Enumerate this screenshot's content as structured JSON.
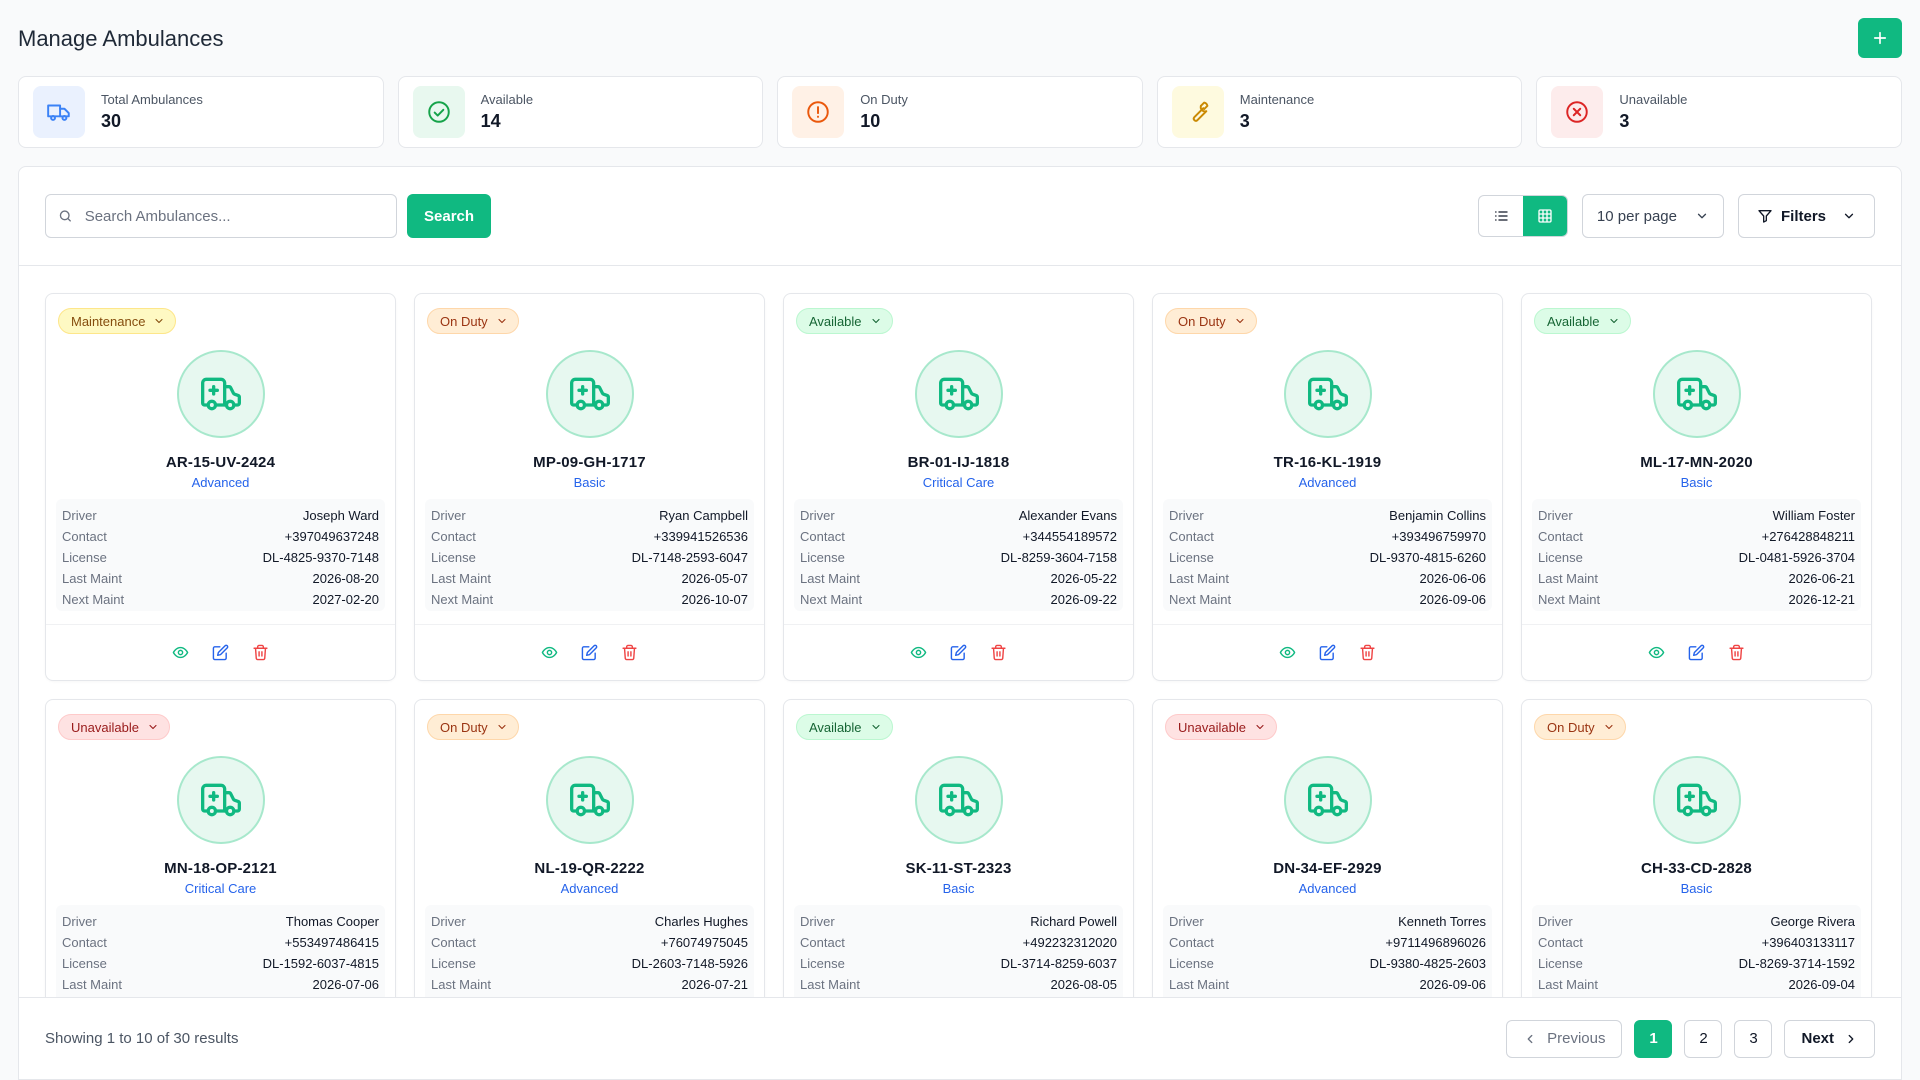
{
  "header": {
    "title": "Manage Ambulances"
  },
  "stats": [
    {
      "label": "Total Ambulances",
      "value": "30",
      "icon": "truck-icon"
    },
    {
      "label": "Available",
      "value": "14",
      "icon": "check-circle-icon"
    },
    {
      "label": "On Duty",
      "value": "10",
      "icon": "alert-circle-icon"
    },
    {
      "label": "Maintenance",
      "value": "3",
      "icon": "wrench-icon"
    },
    {
      "label": "Unavailable",
      "value": "3",
      "icon": "x-circle-icon"
    }
  ],
  "toolbar": {
    "search_placeholder": "Search Ambulances...",
    "search_label": "Search",
    "per_page": "10 per page",
    "filters_label": "Filters"
  },
  "labels": {
    "driver": "Driver",
    "contact": "Contact",
    "license": "License",
    "last_maint": "Last Maint",
    "next_maint": "Next Maint"
  },
  "cards": [
    {
      "status": "Maintenance",
      "plate": "AR-15-UV-2424",
      "type": "Advanced",
      "driver": "Joseph Ward",
      "contact": "+397049637248",
      "license": "DL-4825-9370-7148",
      "last_maint": "2026-08-20",
      "next_maint": "2027-02-20"
    },
    {
      "status": "On Duty",
      "plate": "MP-09-GH-1717",
      "type": "Basic",
      "driver": "Ryan Campbell",
      "contact": "+339941526536",
      "license": "DL-7148-2593-6047",
      "last_maint": "2026-05-07",
      "next_maint": "2026-10-07"
    },
    {
      "status": "Available",
      "plate": "BR-01-IJ-1818",
      "type": "Critical Care",
      "driver": "Alexander Evans",
      "contact": "+344554189572",
      "license": "DL-8259-3604-7158",
      "last_maint": "2026-05-22",
      "next_maint": "2026-09-22"
    },
    {
      "status": "On Duty",
      "plate": "TR-16-KL-1919",
      "type": "Advanced",
      "driver": "Benjamin Collins",
      "contact": "+393496759970",
      "license": "DL-9370-4815-6260",
      "last_maint": "2026-06-06",
      "next_maint": "2026-09-06"
    },
    {
      "status": "Available",
      "plate": "ML-17-MN-2020",
      "type": "Basic",
      "driver": "William Foster",
      "contact": "+276428848211",
      "license": "DL-0481-5926-3704",
      "last_maint": "2026-06-21",
      "next_maint": "2026-12-21"
    },
    {
      "status": "Unavailable",
      "plate": "MN-18-OP-2121",
      "type": "Critical Care",
      "driver": "Thomas Cooper",
      "contact": "+553497486415",
      "license": "DL-1592-6037-4815",
      "last_maint": "2026-07-06",
      "next_maint": ""
    },
    {
      "status": "On Duty",
      "plate": "NL-19-QR-2222",
      "type": "Advanced",
      "driver": "Charles Hughes",
      "contact": "+76074975045",
      "license": "DL-2603-7148-5926",
      "last_maint": "2026-07-21",
      "next_maint": ""
    },
    {
      "status": "Available",
      "plate": "SK-11-ST-2323",
      "type": "Basic",
      "driver": "Richard Powell",
      "contact": "+492232312020",
      "license": "DL-3714-8259-6037",
      "last_maint": "2026-08-05",
      "next_maint": ""
    },
    {
      "status": "Unavailable",
      "plate": "DN-34-EF-2929",
      "type": "Advanced",
      "driver": "Kenneth Torres",
      "contact": "+9711496896026",
      "license": "DL-9380-4825-2603",
      "last_maint": "2026-09-06",
      "next_maint": ""
    },
    {
      "status": "On Duty",
      "plate": "CH-33-CD-2828",
      "type": "Basic",
      "driver": "George Rivera",
      "contact": "+396403133117",
      "license": "DL-8269-3714-1592",
      "last_maint": "2026-09-04",
      "next_maint": ""
    }
  ],
  "footer": {
    "results_text": "Showing 1 to 10 of 30 results",
    "previous": "Previous",
    "pages": [
      "1",
      "2",
      "3"
    ],
    "next": "Next"
  },
  "colors": {
    "accent": "#10b981",
    "type_link": "#2563eb"
  }
}
